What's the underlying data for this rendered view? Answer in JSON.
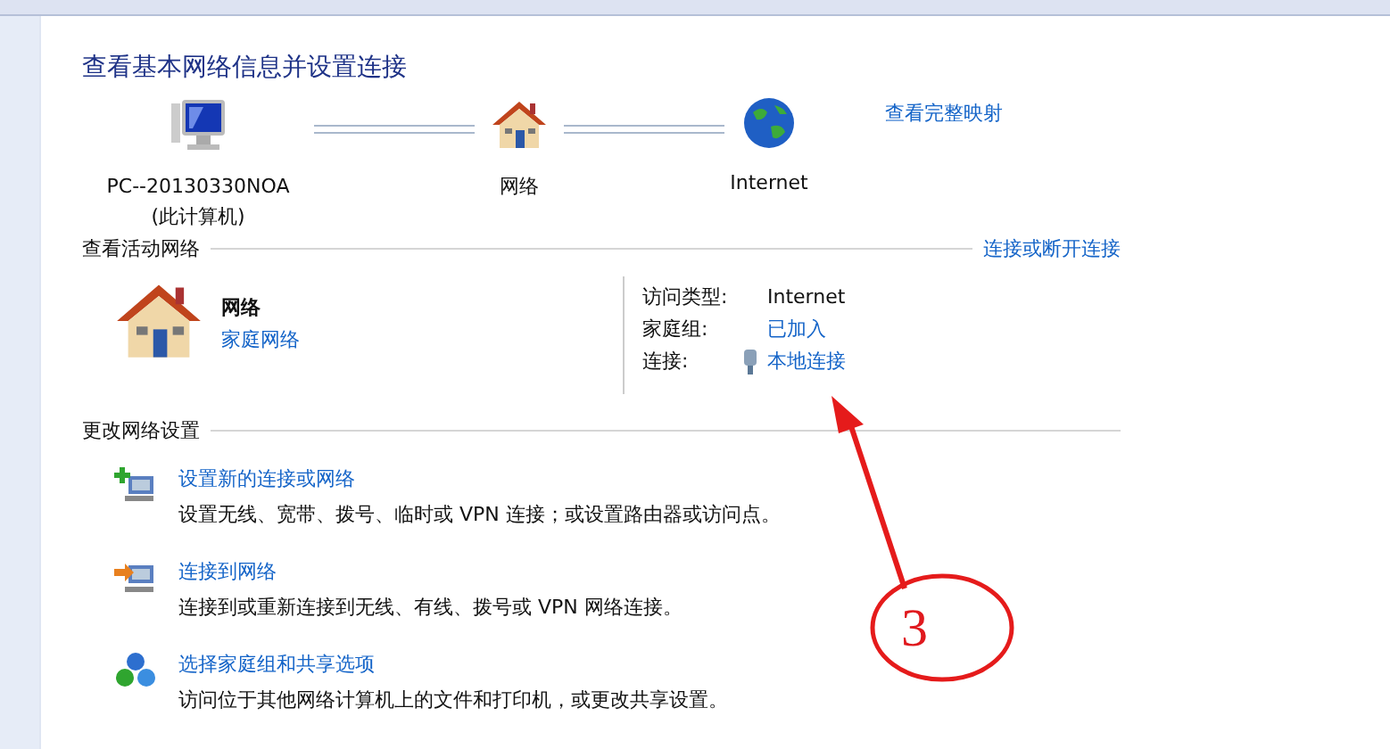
{
  "title": "查看基本网络信息并设置连接",
  "map": {
    "nodes": [
      {
        "kind": "computer",
        "label": "PC--20130330NOA",
        "sublabel": "(此计算机)"
      },
      {
        "kind": "house",
        "label": "网络"
      },
      {
        "kind": "globe",
        "label": "Internet"
      }
    ],
    "link": "查看完整映射"
  },
  "active": {
    "heading": "查看活动网络",
    "link": "连接或断开连接",
    "name": "网络",
    "type": "家庭网络",
    "props": [
      {
        "label": "访问类型:",
        "value": "Internet",
        "kind": "text"
      },
      {
        "label": "家庭组:",
        "value": "已加入",
        "kind": "link"
      },
      {
        "label": "连接:",
        "value": "本地连接",
        "kind": "connection"
      }
    ]
  },
  "settings": {
    "heading": "更改网络设置",
    "items": [
      {
        "kind": "new",
        "title": "设置新的连接或网络",
        "desc": "设置无线、宽带、拨号、临时或 VPN 连接；或设置路由器或访问点。"
      },
      {
        "kind": "connect",
        "title": "连接到网络",
        "desc": "连接到或重新连接到无线、有线、拨号或 VPN 网络连接。"
      },
      {
        "kind": "homegroup",
        "title": "选择家庭组和共享选项",
        "desc": "访问位于其他网络计算机上的文件和打印机，或更改共享设置。"
      }
    ]
  },
  "annotation": {
    "number": "3"
  }
}
